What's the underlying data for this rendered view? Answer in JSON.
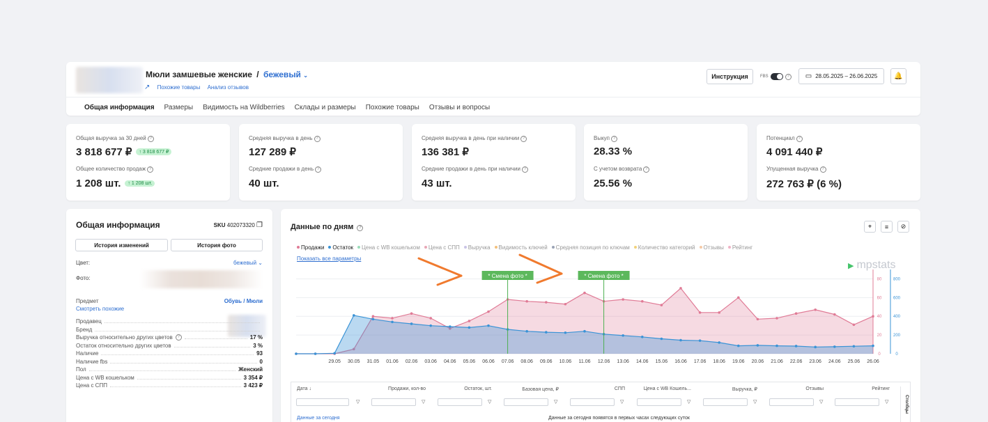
{
  "header": {
    "product_title": "Мюли замшевые женские",
    "separator": "/",
    "color_variant": "бежевый",
    "links": [
      "Похожие товары",
      "Анализ отзывов"
    ],
    "instruction_button": "Инструкция",
    "fbs_label": "FBS",
    "date_range": "28.05.2025 – 26.06.2025"
  },
  "tabs": [
    "Общая информация",
    "Размеры",
    "Видимость на Wildberries",
    "Склады и размеры",
    "Похожие товары",
    "Отзывы и вопросы"
  ],
  "stats": [
    {
      "label1": "Общая выручка за 30 дней",
      "value1": "3 818 677 ₽",
      "badge1": "↑ 3 818 677 ₽",
      "label2": "Общее количество продаж",
      "value2": "1 208 шт.",
      "badge2": "↑ 1 208 шт."
    },
    {
      "label1": "Средняя выручка в день",
      "value1": "127 289 ₽",
      "badge1": "",
      "label2": "Средние продажи в день",
      "value2": "40 шт.",
      "badge2": ""
    },
    {
      "label1": "Средняя выручка в день при наличии",
      "value1": "136 381 ₽",
      "badge1": "",
      "label2": "Средние продажи в день при наличии",
      "value2": "43 шт.",
      "badge2": ""
    },
    {
      "label1": "Выкуп",
      "value1": "28.33 %",
      "badge1": "",
      "label2": "С учетом возврата",
      "value2": "25.56 %",
      "badge2": ""
    },
    {
      "label1": "Потенциал",
      "value1": "4 091 440 ₽",
      "badge1": "",
      "label2": "Упущенная выручка",
      "value2": "272 763 ₽ (6 %)",
      "badge2": ""
    }
  ],
  "info": {
    "title": "Общая информация",
    "sku_label": "SKU",
    "sku": "402073320",
    "history_changes": "История изменений",
    "history_photo": "История фото",
    "color_label": "Цвет:",
    "color_value": "бежевый",
    "photo_label": "Фото:",
    "subject_label": "Предмет",
    "subject_value": "Обувь / Мюли",
    "see_similar": "Смотреть похожие",
    "rows": [
      {
        "label": "Продавец",
        "value": ""
      },
      {
        "label": "Бренд",
        "value": ""
      },
      {
        "label": "Выручка относительно других цветов",
        "value": "17 %"
      },
      {
        "label": "Остаток относительно других цветов",
        "value": "3 %"
      },
      {
        "label": "Наличие",
        "value": "93"
      },
      {
        "label": "Наличие fbs",
        "value": "0"
      },
      {
        "label": "Пол",
        "value": "Женский"
      },
      {
        "label": "Цена с WB кошельком",
        "value": "3 354 ₽"
      },
      {
        "label": "Цена с СПП",
        "value": "3 423 ₽"
      }
    ]
  },
  "daily": {
    "title": "Данные по дням",
    "show_all": "Показать все параметры",
    "brand": "mpstats",
    "legend": [
      {
        "name": "Продажи",
        "color": "#e07b96",
        "active": true
      },
      {
        "name": "Остаток",
        "color": "#3a93d6",
        "active": true
      },
      {
        "name": "Цена с WB кошельком",
        "color": "#9bdcb9",
        "active": false
      },
      {
        "name": "Цена с СПП",
        "color": "#e8a7b6",
        "active": false
      },
      {
        "name": "Выручка",
        "color": "#c9c4e6",
        "active": false
      },
      {
        "name": "Видимость ключей",
        "color": "#f3c07a",
        "active": false
      },
      {
        "name": "Средняя позиция по ключам",
        "color": "#9aa3b5",
        "active": false
      },
      {
        "name": "Количество категорий",
        "color": "#f2d27a",
        "active": false
      },
      {
        "name": "Отзывы",
        "color": "#f5c9a6",
        "active": false
      },
      {
        "name": "Рейтинг",
        "color": "#f0b3c6",
        "active": false
      }
    ],
    "table_headers": [
      "Дата ↓",
      "Продажи, кол-во",
      "Остаток, шт.",
      "Базовая цена, ₽",
      "СПП",
      "Цена с WB Кошель...",
      "Выручка, ₽",
      "Отзывы",
      "Рейтинг"
    ],
    "today_label": "Данные за сегодня",
    "today_note": "Данные за сегодня появятся в первых часах следующих суток",
    "columns_label": "Столбцы"
  },
  "chart_data": {
    "type": "area",
    "x": [
      "27.05",
      "28.05",
      "29.05",
      "30.05",
      "31.05",
      "01.06",
      "02.06",
      "03.06",
      "04.06",
      "05.06",
      "06.06",
      "07.06",
      "08.06",
      "09.06",
      "10.06",
      "11.06",
      "12.06",
      "13.06",
      "14.06",
      "15.06",
      "16.06",
      "17.06",
      "18.06",
      "19.06",
      "20.06",
      "21.06",
      "22.06",
      "23.06",
      "24.06",
      "25.06",
      "26.06"
    ],
    "tick_labels": [
      "29.05",
      "30.05",
      "31.05",
      "01.06",
      "02.06",
      "03.06",
      "04.06",
      "05.06",
      "06.06",
      "07.06",
      "08.06",
      "09.06",
      "10.06",
      "11.06",
      "12.06",
      "13.06",
      "14.06",
      "15.06",
      "16.06",
      "17.06",
      "18.06",
      "19.06",
      "20.06",
      "21.06",
      "22.06",
      "23.06",
      "24.06",
      "25.06",
      "26.06"
    ],
    "series": [
      {
        "name": "Продажи",
        "axis": "left",
        "color": "#e07b96",
        "values": [
          0,
          0,
          0,
          5,
          40,
          38,
          43,
          38,
          27,
          35,
          45,
          58,
          56,
          55,
          53,
          65,
          56,
          58,
          56,
          52,
          70,
          44,
          44,
          60,
          37,
          38,
          43,
          47,
          42,
          31,
          40,
          34
        ]
      },
      {
        "name": "Остаток",
        "axis": "right",
        "color": "#3a93d6",
        "values": [
          0,
          0,
          5,
          410,
          370,
          340,
          320,
          300,
          290,
          280,
          300,
          260,
          240,
          230,
          225,
          240,
          210,
          195,
          180,
          160,
          145,
          140,
          120,
          85,
          90,
          85,
          82,
          72,
          75,
          80,
          85,
          100
        ]
      }
    ],
    "left_axis": {
      "ticks": [
        0,
        20,
        40,
        60,
        80
      ],
      "ylim": [
        0,
        90
      ]
    },
    "right_axis": {
      "ticks": [
        0,
        200,
        400,
        600,
        800
      ],
      "ylim": [
        0,
        900
      ]
    },
    "annotations": [
      {
        "x": "07.06",
        "label": "* Смена фото *"
      },
      {
        "x": "12.06",
        "label": "* Смена фото *"
      }
    ]
  }
}
